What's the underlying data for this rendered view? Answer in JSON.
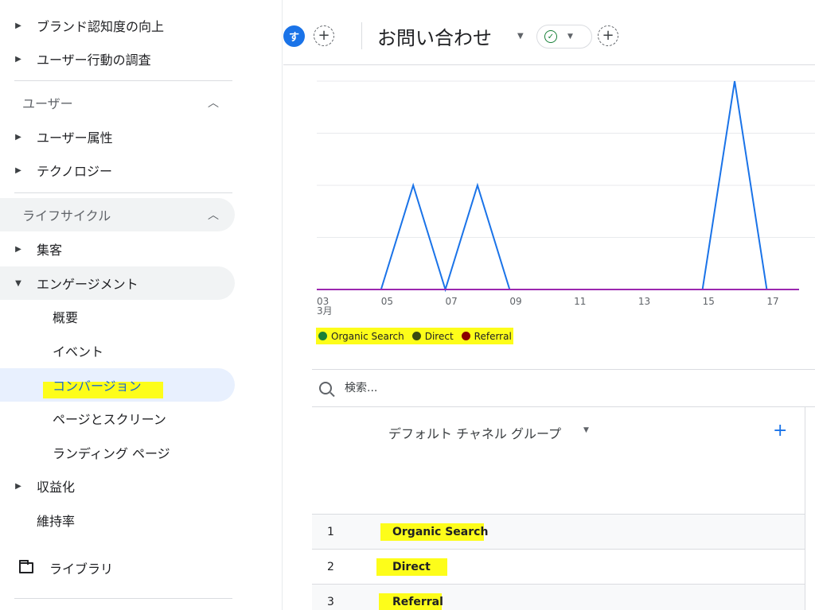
{
  "sidebar": {
    "top_items": [
      {
        "label": "ブランド認知度の向上"
      },
      {
        "label": "ユーザー行動の調査"
      }
    ],
    "section_user": {
      "label": "ユーザー",
      "chevron": "▲"
    },
    "user_items": [
      {
        "label": "ユーザー属性"
      },
      {
        "label": "テクノロジー"
      }
    ],
    "section_lifecycle": {
      "label": "ライフサイクル",
      "chevron": "▲"
    },
    "lifecycle_items": [
      {
        "label": "集客",
        "expanded": false
      },
      {
        "label": "エンゲージメント",
        "expanded": true
      }
    ],
    "engagement_sub": [
      {
        "label": "概要"
      },
      {
        "label": "イベント"
      },
      {
        "label": "コンバージョン",
        "active": true
      },
      {
        "label": "ページとスクリーン"
      },
      {
        "label": "ランディング ページ"
      }
    ],
    "monetization": {
      "label": "収益化"
    },
    "retention": {
      "label": "維持率"
    },
    "library": {
      "label": "ライブラリ",
      "icon": "folder-icon"
    }
  },
  "header": {
    "avatar_letter": "す",
    "title": "お問い合わせ",
    "status_icon": "check-circle-icon",
    "add_icon": "+"
  },
  "chart_data": {
    "type": "line",
    "x_tick_labels": [
      "03",
      "05",
      "07",
      "09",
      "11",
      "13",
      "15",
      "17"
    ],
    "x_month_label": "3月",
    "x": [
      3,
      4,
      5,
      6,
      7,
      8,
      9,
      10,
      11,
      12,
      13,
      14,
      15,
      16,
      17,
      18
    ],
    "series": [
      {
        "name": "Organic Search",
        "color": "#1a73e8",
        "values": [
          0,
          0,
          0,
          2,
          0,
          2,
          0,
          0,
          0,
          0,
          0,
          0,
          0,
          4,
          0,
          0
        ]
      },
      {
        "name": "Direct",
        "color": "#3a4a10",
        "values": [
          0,
          0,
          0,
          0,
          0,
          0,
          0,
          0,
          0,
          0,
          0,
          0,
          0,
          0,
          0,
          0
        ]
      },
      {
        "name": "Referral",
        "color": "#9c27b0",
        "values": [
          0,
          0,
          0,
          0,
          0,
          0,
          0,
          0,
          0,
          0,
          0,
          0,
          0,
          0,
          0,
          0
        ]
      }
    ],
    "xlim": [
      3,
      18.5
    ],
    "ylim": [
      0,
      4
    ],
    "grid": true,
    "legend": [
      {
        "name": "Organic Search",
        "color": "#188038"
      },
      {
        "name": "Direct",
        "color": "#3a4a10"
      },
      {
        "name": "Referral",
        "color": "#8b0000"
      }
    ]
  },
  "search": {
    "placeholder": "検索..."
  },
  "table": {
    "column_header": "デフォルト チャネル グループ",
    "add_column": "+",
    "rows": [
      {
        "index": "1",
        "name": "Organic Search"
      },
      {
        "index": "2",
        "name": "Direct"
      },
      {
        "index": "3",
        "name": "Referral"
      }
    ]
  }
}
